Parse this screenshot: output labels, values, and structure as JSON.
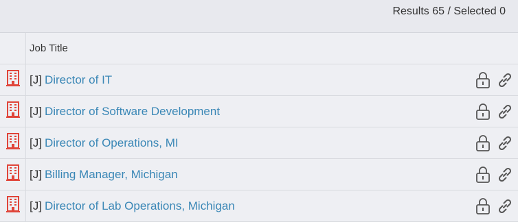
{
  "summary": {
    "results_label": "Results 65 / Selected 0"
  },
  "table": {
    "column_header": "Job Title",
    "rows": [
      {
        "prefix": "[J]",
        "title": "Director of IT"
      },
      {
        "prefix": "[J]",
        "title": "Director of Software Development"
      },
      {
        "prefix": "[J]",
        "title": "Director of Operations, MI"
      },
      {
        "prefix": "[J]",
        "title": "Billing Manager, Michigan"
      },
      {
        "prefix": "[J]",
        "title": "Director of Lab Operations, Michigan"
      }
    ]
  },
  "icons": {
    "row_type": "building-icon",
    "lock": "lock-icon",
    "link": "link-icon"
  },
  "colors": {
    "link": "#3a87b6",
    "building_icon": "#e0453a",
    "action_icon": "#555555"
  }
}
